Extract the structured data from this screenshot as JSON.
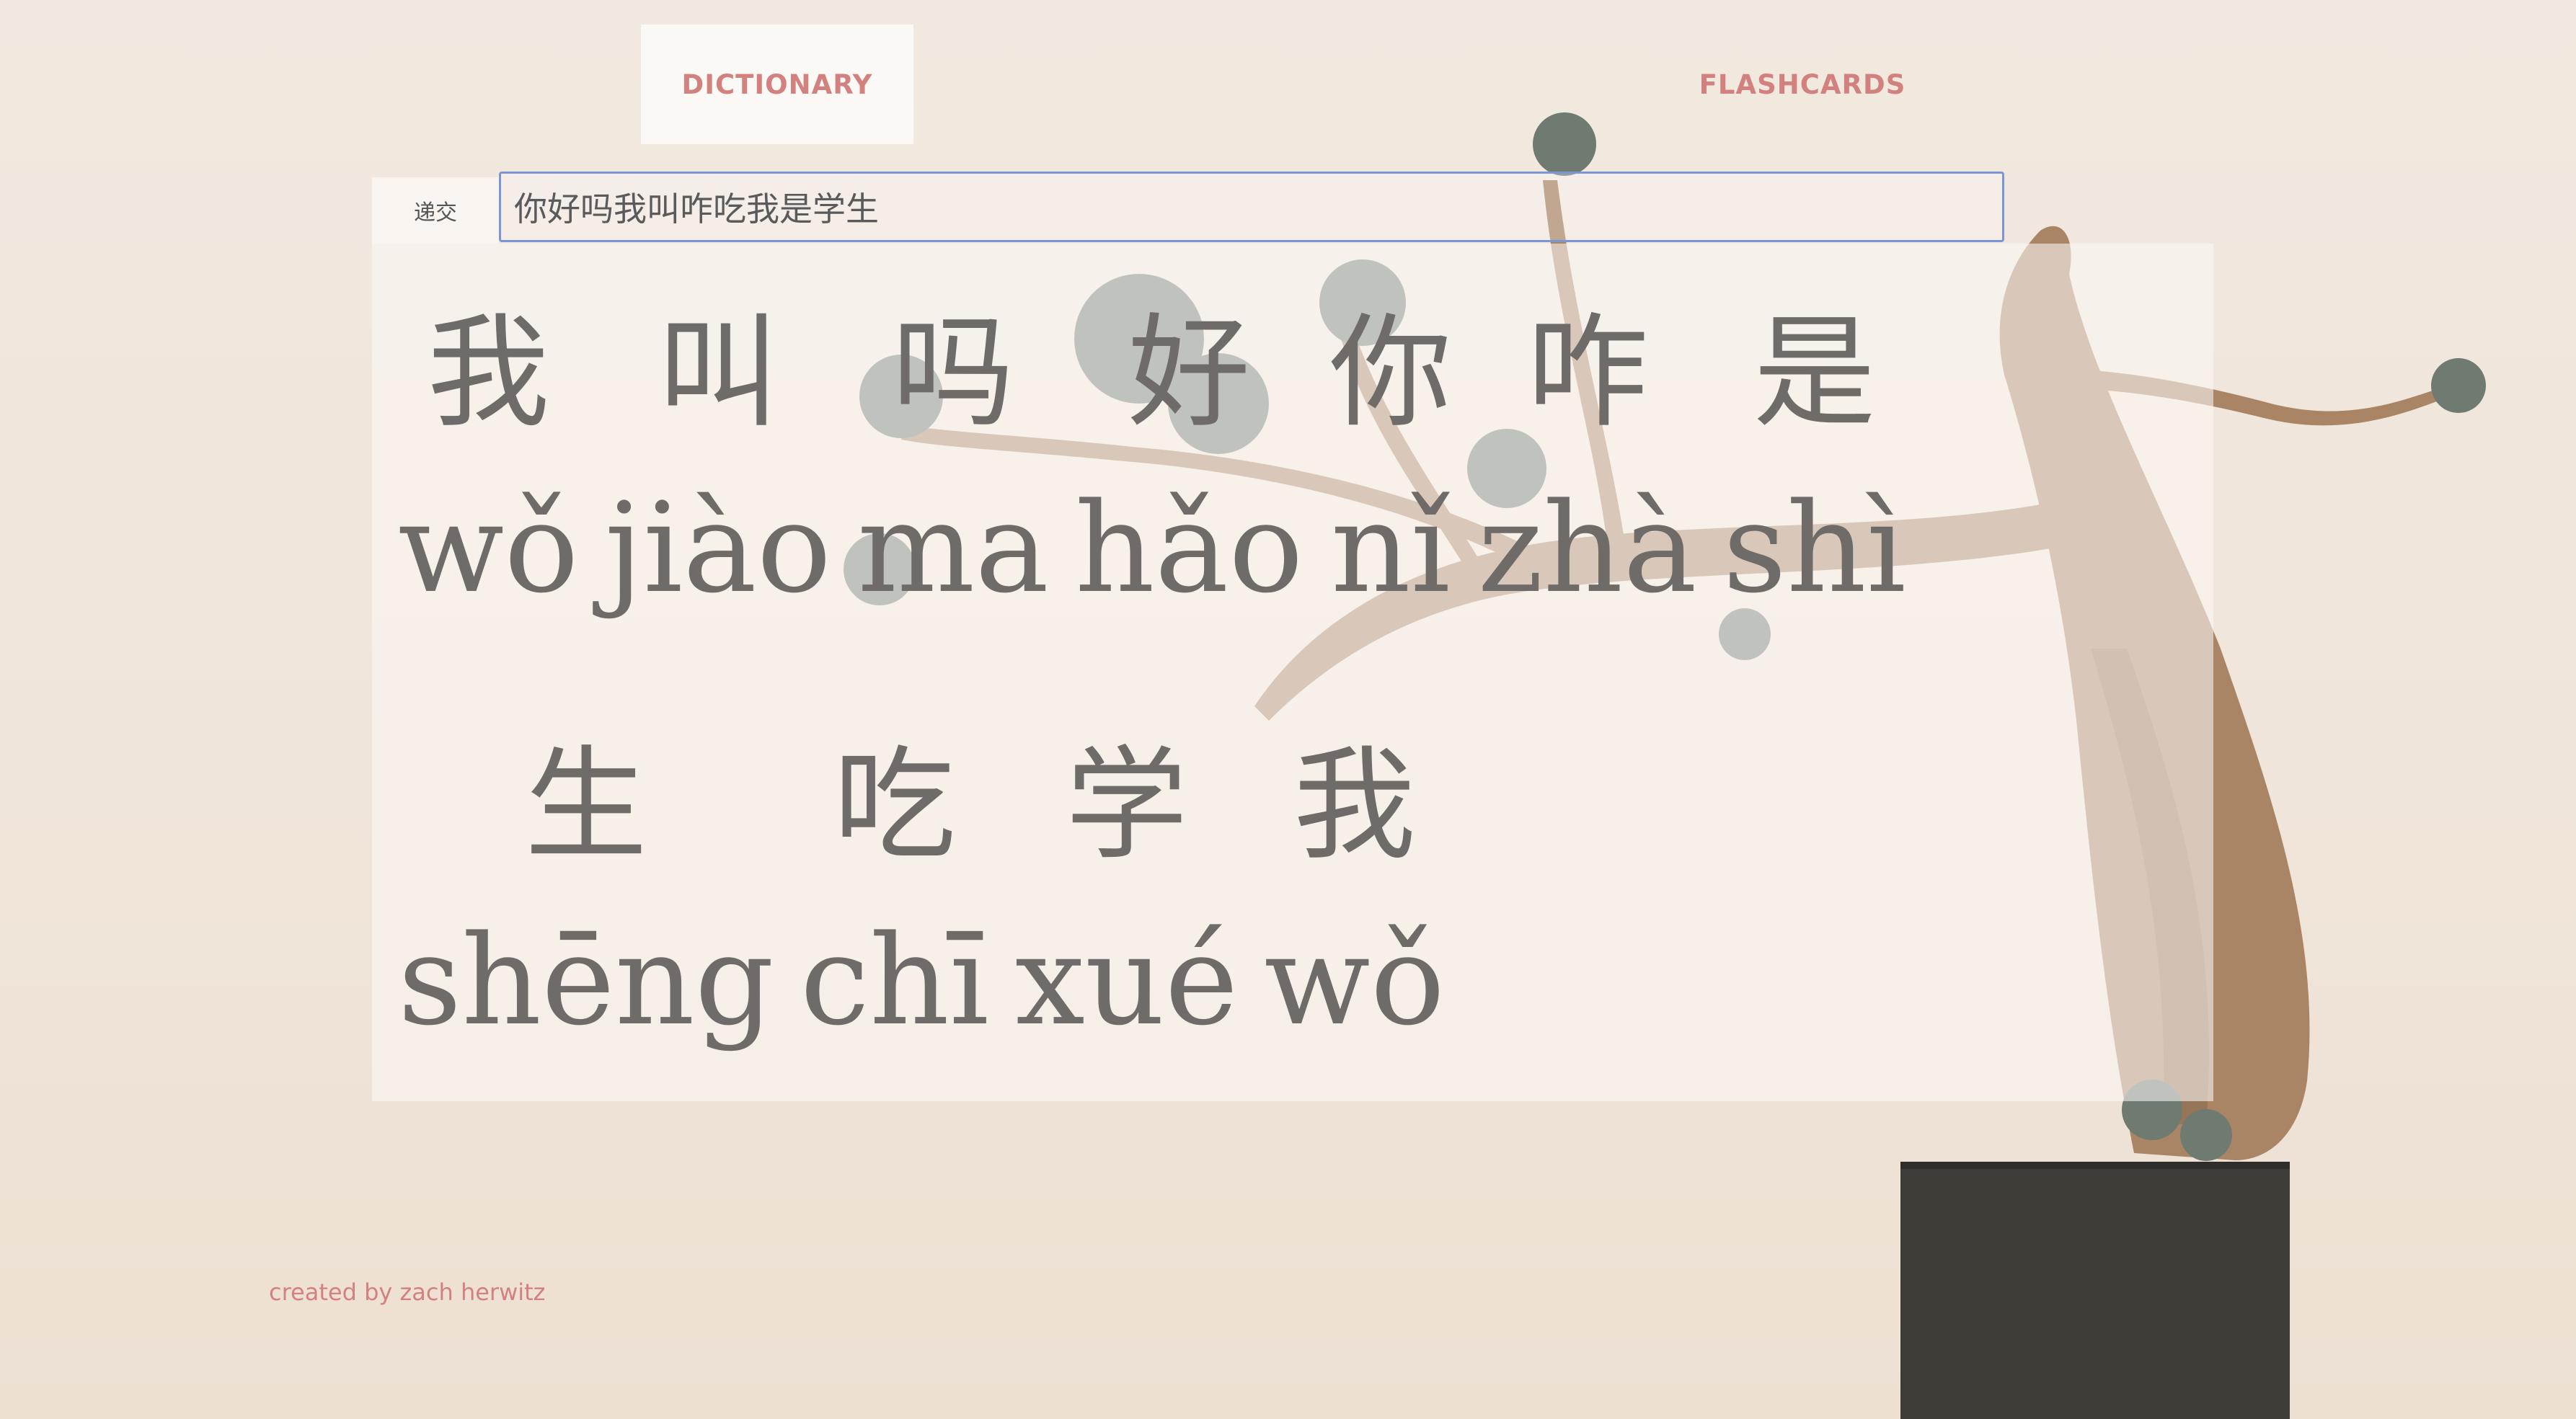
{
  "nav": {
    "dictionary_label": "DICTIONARY",
    "flashcards_label": "FLASHCARDS"
  },
  "search": {
    "submit_label": "递交",
    "value": "你好吗我叫咋吃我是学生"
  },
  "results": [
    [
      {
        "hanzi": "我",
        "pinyin": "wǒ"
      },
      {
        "hanzi": "叫",
        "pinyin": "jiào"
      },
      {
        "hanzi": "吗",
        "pinyin": "ma"
      },
      {
        "hanzi": "好",
        "pinyin": "hǎo"
      },
      {
        "hanzi": "你",
        "pinyin": "nǐ"
      },
      {
        "hanzi": "咋",
        "pinyin": "zhà"
      },
      {
        "hanzi": "是",
        "pinyin": "shì"
      }
    ],
    [
      {
        "hanzi": "生",
        "pinyin": "shēng"
      },
      {
        "hanzi": "吃",
        "pinyin": "chī"
      },
      {
        "hanzi": "学",
        "pinyin": "xué"
      },
      {
        "hanzi": "我",
        "pinyin": "wǒ"
      }
    ]
  ],
  "footer": {
    "credit": "created by zach herwitz"
  },
  "colors": {
    "accent": "#d2817f",
    "text": "#6e6b68",
    "input_border": "#7b96d6",
    "background": "#f1e8df"
  }
}
